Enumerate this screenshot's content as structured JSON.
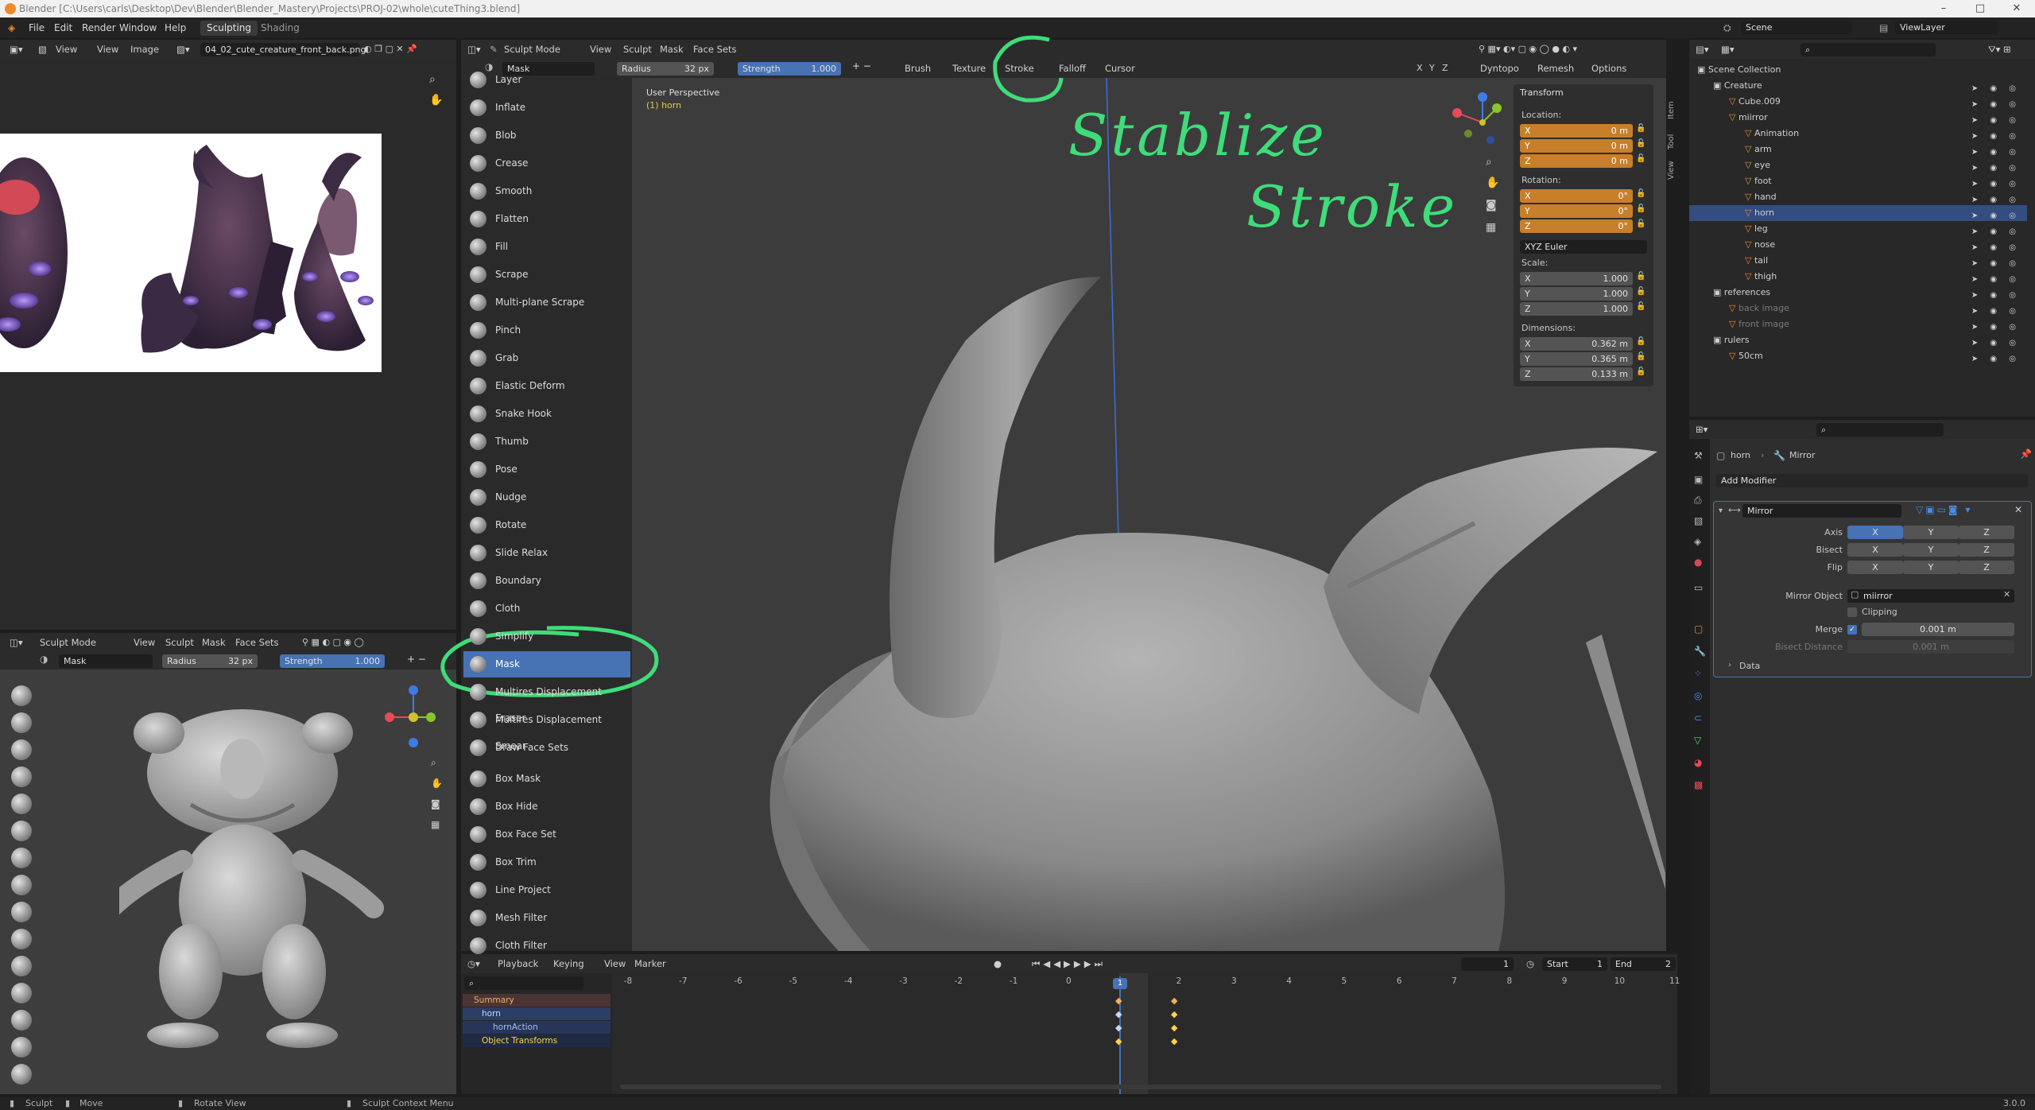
{
  "window": {
    "title": "Blender [C:\\Users\\carls\\Desktop\\Dev\\Blender\\Blender_Mastery\\Projects\\PROJ-02\\whole\\cuteThing3.blend]"
  },
  "menu": {
    "file": "File",
    "edit": "Edit",
    "render": "Render",
    "window": "Window",
    "help": "Help"
  },
  "workspaces": {
    "active": "Sculpting",
    "other": "Shading"
  },
  "scene": {
    "label": "Scene",
    "view_layer": "ViewLayer"
  },
  "image_editor": {
    "view": "View",
    "view2": "View",
    "image": "Image",
    "filename": "04_02_cute_creature_front_back.png"
  },
  "small_view": {
    "mode": "Sculpt Mode",
    "menus": [
      "View",
      "Sculpt",
      "Mask",
      "Face Sets"
    ],
    "brush": "Mask",
    "radius_label": "Radius",
    "radius_value": "32 px",
    "strength_label": "Strength",
    "strength_value": "1.000"
  },
  "main_view": {
    "mode": "Sculpt Mode",
    "menus": [
      "View",
      "Sculpt",
      "Mask",
      "Face Sets"
    ],
    "brush": "Mask",
    "radius_label": "Radius",
    "radius_value": "32 px",
    "strength_label": "Strength",
    "strength_value": "1.000",
    "toolbar": [
      "Brush",
      "Texture",
      "Stroke",
      "Falloff",
      "Cursor"
    ],
    "axes": [
      "X",
      "Y",
      "Z"
    ],
    "dyntopo": "Dyntopo",
    "remesh": "Remesh",
    "options": "Options",
    "perspective": "User Perspective",
    "object": "(1) horn"
  },
  "tools": [
    {
      "label": "Layer"
    },
    {
      "label": "Inflate"
    },
    {
      "label": "Blob"
    },
    {
      "label": "Crease"
    },
    {
      "label": "Smooth"
    },
    {
      "label": "Flatten"
    },
    {
      "label": "Fill"
    },
    {
      "label": "Scrape"
    },
    {
      "label": "Multi-plane Scrape"
    },
    {
      "label": "Pinch"
    },
    {
      "label": "Grab"
    },
    {
      "label": "Elastic Deform"
    },
    {
      "label": "Snake Hook"
    },
    {
      "label": "Thumb"
    },
    {
      "label": "Pose"
    },
    {
      "label": "Nudge"
    },
    {
      "label": "Rotate"
    },
    {
      "label": "Slide Relax"
    },
    {
      "label": "Boundary"
    },
    {
      "label": "Cloth"
    },
    {
      "label": "Simplify"
    },
    {
      "label": "Mask"
    },
    {
      "label": "Multires Displacement Eraser"
    },
    {
      "label": "Multires Displacement Smear"
    },
    {
      "label": "Draw Face Sets"
    },
    {
      "label": "Box Mask"
    },
    {
      "label": "Box Hide"
    },
    {
      "label": "Box Face Set"
    },
    {
      "label": "Box Trim"
    },
    {
      "label": "Line Project"
    },
    {
      "label": "Mesh Filter"
    },
    {
      "label": "Cloth Filter"
    }
  ],
  "transform": {
    "title": "Transform",
    "location_label": "Location:",
    "location": [
      {
        "axis": "X",
        "value": "0 m"
      },
      {
        "axis": "Y",
        "value": "0 m"
      },
      {
        "axis": "Z",
        "value": "0 m"
      }
    ],
    "rotation_label": "Rotation:",
    "rotation": [
      {
        "axis": "X",
        "value": "0°"
      },
      {
        "axis": "Y",
        "value": "0°"
      },
      {
        "axis": "Z",
        "value": "0°"
      }
    ],
    "rotation_mode": "XYZ Euler",
    "scale_label": "Scale:",
    "scale": [
      {
        "axis": "X",
        "value": "1.000"
      },
      {
        "axis": "Y",
        "value": "1.000"
      },
      {
        "axis": "Z",
        "value": "1.000"
      }
    ],
    "dimensions_label": "Dimensions:",
    "dimensions": [
      {
        "axis": "X",
        "value": "0.362 m"
      },
      {
        "axis": "Y",
        "value": "0.365 m"
      },
      {
        "axis": "Z",
        "value": "0.133 m"
      }
    ]
  },
  "sidebar_tabs": [
    "Item",
    "Tool",
    "View"
  ],
  "outliner": {
    "rows": [
      {
        "label": "Scene Collection"
      },
      {
        "label": "Creature"
      },
      {
        "label": "Cube.009"
      },
      {
        "label": "miirror"
      },
      {
        "label": "Animation"
      },
      {
        "label": "arm"
      },
      {
        "label": "eye"
      },
      {
        "label": "foot"
      },
      {
        "label": "hand"
      },
      {
        "label": "horn"
      },
      {
        "label": "leg"
      },
      {
        "label": "nose"
      },
      {
        "label": "tail"
      },
      {
        "label": "thigh"
      },
      {
        "label": "references"
      },
      {
        "label": "back image"
      },
      {
        "label": "front image"
      },
      {
        "label": "rulers"
      },
      {
        "label": "50cm"
      }
    ]
  },
  "properties": {
    "object": "horn",
    "modifier_name": "Mirror",
    "add_modifier": "Add Modifier",
    "modifier_field": "Mirror",
    "axis_label": "Axis",
    "bisect_label": "Bisect",
    "flip_label": "Flip",
    "axes": [
      "X",
      "Y",
      "Z"
    ],
    "mirror_object_label": "Mirror Object",
    "mirror_object": "miirror",
    "clipping": "Clipping",
    "merge_label": "Merge",
    "merge_value": "0.001 m",
    "bisect_distance_label": "Bisect Distance",
    "bisect_distance_value": "0.001 m",
    "data": "Data"
  },
  "timeline": {
    "menus": [
      "Playback",
      "Keying",
      "View",
      "Marker"
    ],
    "current_frame": "1",
    "start_label": "Start",
    "start": "1",
    "end_label": "End",
    "end": "2",
    "ticks": [
      "-8",
      "-7",
      "-6",
      "-5",
      "-4",
      "-3",
      "-2",
      "-1",
      "0",
      "1",
      "2",
      "3",
      "4",
      "5",
      "6",
      "7",
      "8",
      "9",
      "10",
      "11"
    ],
    "channels": [
      "Summary",
      "horn",
      "hornAction",
      "Object Transforms"
    ]
  },
  "annotation": {
    "line1": "Stablize",
    "line2": "Stroke"
  },
  "statusbar": {
    "sculpt": "Sculpt",
    "move": "Move",
    "rotate": "Rotate View",
    "context": "Sculpt Context Menu",
    "version": "3.0.0"
  },
  "colors": {
    "accent_blue": "#4772b3",
    "orange_field": "#c77f2b",
    "annotation_green": "#3fdc7a",
    "selected_row": "#334d80"
  }
}
